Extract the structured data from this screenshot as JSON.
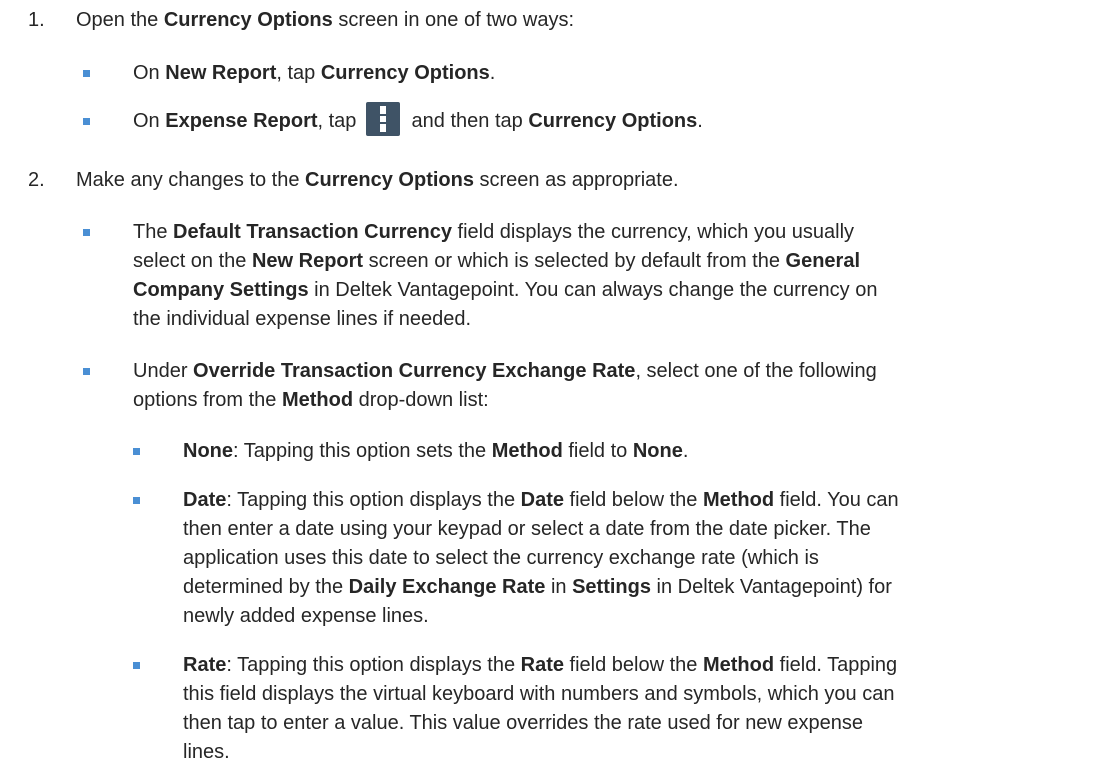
{
  "steps": [
    {
      "number": "1.",
      "parts": [
        "Open the ",
        "Currency Options",
        " screen in one of two ways:"
      ],
      "bullets": [
        {
          "parts": [
            "On ",
            "New Report",
            ", tap ",
            "Currency Options",
            "."
          ]
        },
        {
          "parts": [
            "On ",
            "Expense Report",
            ", tap ",
            " and then tap ",
            "Currency Options",
            "."
          ],
          "icon": "vertical-ellipsis-menu-icon"
        }
      ]
    },
    {
      "number": "2.",
      "parts": [
        "Make any changes to the ",
        "Currency Options",
        " screen as appropriate."
      ],
      "bullets": [
        {
          "lines": [
            [
              "The ",
              "Default Transaction Currency",
              " field displays the currency, which you usually"
            ],
            [
              "select on the ",
              "New Report",
              " screen or which is selected by default from the ",
              "General"
            ],
            [
              "Company Settings",
              " in Deltek Vantagepoint. You can always change the currency on"
            ],
            [
              "the individual expense lines if needed."
            ]
          ]
        },
        {
          "lines": [
            [
              "Under ",
              "Override Transaction Currency Exchange Rate",
              ", select one of the following"
            ],
            [
              "options from the ",
              "Method",
              " drop-down list:"
            ]
          ],
          "sub_bullets": [
            {
              "lines": [
                [
                  "None",
                  ": Tapping this option sets the ",
                  "Method",
                  " field to ",
                  "None",
                  "."
                ]
              ]
            },
            {
              "lines": [
                [
                  "Date",
                  ": Tapping this option displays the ",
                  "Date",
                  " field below the ",
                  "Method",
                  " field. You can"
                ],
                [
                  "then enter a date using your keypad or select a date from the date picker. The"
                ],
                [
                  "application uses this date to select the currency exchange rate (which is"
                ],
                [
                  "determined by the ",
                  "Daily Exchange Rate",
                  " in ",
                  "Settings",
                  " in Deltek Vantagepoint) for"
                ],
                [
                  "newly added expense lines."
                ]
              ]
            },
            {
              "lines": [
                [
                  "Rate",
                  ": Tapping this option displays the ",
                  "Rate",
                  " field below the ",
                  "Method",
                  " field. Tapping"
                ],
                [
                  "this field displays the virtual keyboard with numbers and symbols, which you can"
                ],
                [
                  "then tap to enter a value. This value overrides the rate used for new expense"
                ],
                [
                  "lines."
                ]
              ]
            }
          ]
        }
      ]
    }
  ],
  "colors": {
    "bullet": "#4a8fd4",
    "text": "#262626",
    "icon_bg": "#3f5366"
  }
}
